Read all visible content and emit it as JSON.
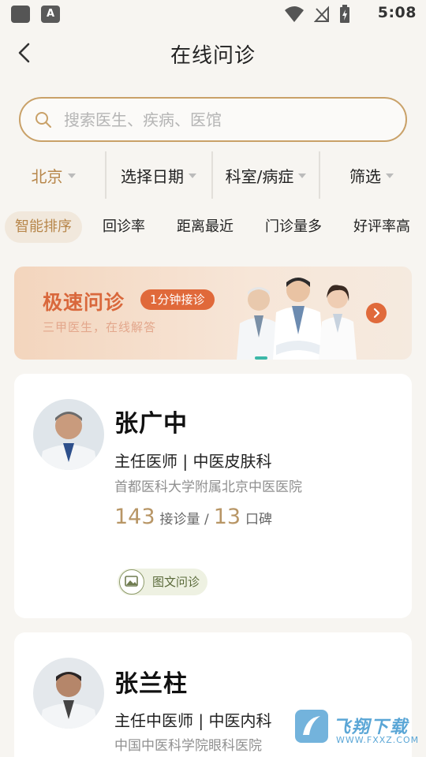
{
  "status_bar": {
    "time": "5:08",
    "app_badge": "A"
  },
  "header": {
    "title": "在线问诊"
  },
  "search": {
    "placeholder": "搜索医生、疾病、医馆"
  },
  "filters": [
    "北京",
    "选择日期",
    "科室/病症",
    "筛选"
  ],
  "sorts": [
    "智能排序",
    "回诊率",
    "距离最近",
    "门诊量多",
    "好评率高"
  ],
  "banner": {
    "title": "极速问诊",
    "badge": "1分钟接诊",
    "subtitle": "三甲医生，在线解答"
  },
  "doctors": [
    {
      "name": "张广中",
      "role": "主任医师 | 中医皮肤科",
      "hospital": "首都医科大学附属北京中医医院",
      "consultations": "143",
      "consultations_label": "接诊量 /",
      "reputation": "13",
      "reputation_label": "口碑",
      "tag": "图文问诊"
    },
    {
      "name": "张兰柱",
      "role": "主任中医师 | 中医内科",
      "hospital": "中国中医科学院眼科医院"
    }
  ],
  "watermark": {
    "text": "飞翔下载",
    "url": "WWW.FXXZ.COM"
  },
  "colors": {
    "accent": "#b7864a",
    "banner_orange": "#e0693a",
    "stat_gold": "#b89666"
  }
}
